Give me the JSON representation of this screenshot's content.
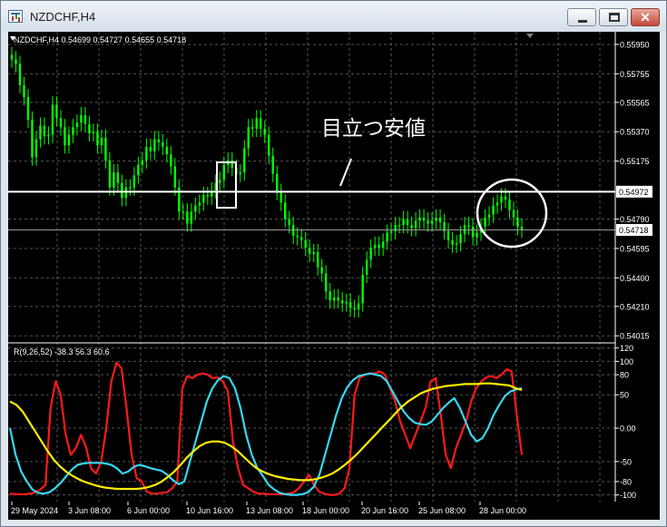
{
  "window": {
    "title": "NZDCHF,H4",
    "icon": "chart-window-icon",
    "buttons": {
      "minimize": "minimize-icon",
      "maximize": "maximize-icon",
      "close_glyph": "✕"
    }
  },
  "chart": {
    "symbol_info": "NZDCHF,H4  0.54699 0.54727 0.54655 0.54718",
    "price_axis": {
      "labels": [
        "0.55950",
        "0.55755",
        "0.55565",
        "0.55370",
        "0.55175",
        "0.54790",
        "0.54595",
        "0.54400",
        "0.54210",
        "0.54015"
      ],
      "horizontal_line_label": "0.54972",
      "current_price_label": "0.54718",
      "ylim": [
        0.5398,
        0.5601
      ]
    },
    "annotation": {
      "text": "目立つ安値"
    },
    "time_axis": [
      "29 May 2024",
      "3 Jun 08:00",
      "6 Jun 00:00",
      "10 Jun 16:00",
      "13 Jun 08:00",
      "18 Jun 00:00",
      "20 Jun 16:00",
      "25 Jun 08:00",
      "28 Jun 00:00"
    ],
    "indicator": {
      "label": "R(9,26,52) -38.3 56.3 60.6",
      "axis_labels": [
        "120",
        "100",
        "80",
        "50",
        "0.00",
        "-50",
        "-80",
        "-100"
      ],
      "ylim": [
        -110,
        125
      ]
    },
    "colors": {
      "background": "#000000",
      "candles": "#00ff00",
      "red_line": "#ff1a1a",
      "cyan_line": "#37d7f0",
      "yellow_line": "#ffee00",
      "grid": "#9a9a9a",
      "annotation": "#ffffff"
    }
  },
  "chart_data": {
    "type": "line",
    "price_series": {
      "closes": [
        0.5585,
        0.5582,
        0.5568,
        0.556,
        0.5545,
        0.552,
        0.5532,
        0.5541,
        0.5534,
        0.5535,
        0.5555,
        0.5546,
        0.554,
        0.5528,
        0.5535,
        0.554,
        0.5543,
        0.5548,
        0.5542,
        0.5536,
        0.5537,
        0.5528,
        0.5533,
        0.5518,
        0.55,
        0.551,
        0.5503,
        0.5493,
        0.55,
        0.55,
        0.5508,
        0.5515,
        0.5518,
        0.5527,
        0.5524,
        0.5532,
        0.553,
        0.5527,
        0.5522,
        0.5514,
        0.55,
        0.5484,
        0.5484,
        0.5476,
        0.5484,
        0.5488,
        0.549,
        0.5495,
        0.5494,
        0.5498,
        0.5503,
        0.5505,
        0.5515,
        0.5518,
        0.5513,
        0.5509,
        0.551,
        0.5526,
        0.554,
        0.5539,
        0.5546,
        0.5539,
        0.5535,
        0.5521,
        0.5509,
        0.5497,
        0.549,
        0.5479,
        0.5475,
        0.5468,
        0.5467,
        0.5465,
        0.546,
        0.5456,
        0.5457,
        0.5447,
        0.5443,
        0.5431,
        0.5425,
        0.5427,
        0.5425,
        0.5423,
        0.5424,
        0.542,
        0.5419,
        0.5423,
        0.5442,
        0.5452,
        0.546,
        0.5462,
        0.546,
        0.5464,
        0.547,
        0.5471,
        0.5475,
        0.5475,
        0.5479,
        0.5475,
        0.5473,
        0.5478,
        0.548,
        0.5478,
        0.5476,
        0.5478,
        0.548,
        0.5477,
        0.5471,
        0.5465,
        0.5462,
        0.5463,
        0.5469,
        0.5475,
        0.5474,
        0.5467,
        0.547,
        0.5474,
        0.548,
        0.5482,
        0.5488,
        0.549,
        0.5494,
        0.5492,
        0.5485,
        0.548,
        0.5474,
        0.5472
      ],
      "horizontal_line": 0.54972,
      "current_price": 0.54718
    },
    "indicator_series": [
      {
        "name": "red",
        "values": [
          -98,
          -99,
          -99,
          -99,
          -98,
          -96,
          -92,
          -85,
          30,
          70,
          50,
          -10,
          -40,
          -30,
          -10,
          -28,
          -60,
          -68,
          -50,
          0,
          70,
          98,
          90,
          30,
          -40,
          -75,
          -80,
          -95,
          -98,
          -98,
          -97,
          -96,
          -90,
          -80,
          60,
          78,
          75,
          80,
          82,
          80,
          75,
          76,
          70,
          55,
          -20,
          -60,
          -85,
          -90,
          -95,
          -98,
          -98,
          -99,
          -99,
          -99,
          -99,
          -98,
          -96,
          -90,
          -80,
          -70,
          -85,
          -95,
          -98,
          -100,
          -100,
          -98,
          -90,
          -60,
          50,
          75,
          80,
          82,
          82,
          85,
          80,
          60,
          40,
          10,
          -10,
          -30,
          -10,
          10,
          30,
          70,
          75,
          20,
          -40,
          -60,
          -30,
          -10,
          10,
          40,
          60,
          70,
          76,
          78,
          75,
          80,
          88,
          85,
          20,
          -40
        ]
      },
      {
        "name": "cyan",
        "values": [
          0,
          -40,
          -65,
          -80,
          -92,
          -97,
          -98,
          -96,
          -90,
          -82,
          -72,
          -62,
          -55,
          -53,
          -52,
          -52,
          -52,
          -53,
          -55,
          -60,
          -68,
          -65,
          -58,
          -55,
          -57,
          -60,
          -62,
          -64,
          -70,
          -78,
          -84,
          -80,
          -50,
          -20,
          10,
          40,
          60,
          72,
          78,
          75,
          60,
          30,
          -10,
          -40,
          -60,
          -72,
          -85,
          -92,
          -97,
          -99,
          -100,
          -100,
          -99,
          -96,
          -88,
          -70,
          -40,
          -10,
          20,
          45,
          62,
          72,
          78,
          80,
          82,
          80,
          78,
          70,
          55,
          40,
          25,
          15,
          8,
          6,
          5,
          10,
          20,
          30,
          38,
          45,
          30,
          10,
          -10,
          -20,
          -15,
          0,
          20,
          35,
          48,
          55,
          58,
          60
        ]
      },
      {
        "name": "yellow",
        "values": [
          40,
          35,
          25,
          10,
          -5,
          -20,
          -35,
          -48,
          -58,
          -66,
          -72,
          -77,
          -81,
          -84,
          -87,
          -89,
          -90,
          -91,
          -91,
          -91,
          -91,
          -90,
          -88,
          -85,
          -80,
          -73,
          -65,
          -55,
          -44,
          -35,
          -27,
          -22,
          -20,
          -20,
          -22,
          -27,
          -34,
          -43,
          -52,
          -60,
          -65,
          -69,
          -72,
          -74,
          -76,
          -77,
          -78,
          -78,
          -77,
          -75,
          -72,
          -68,
          -62,
          -55,
          -47,
          -38,
          -28,
          -18,
          -8,
          2,
          12,
          22,
          32,
          40,
          46,
          52,
          56,
          59,
          61,
          63,
          64,
          65,
          66,
          66,
          66,
          67,
          67,
          66,
          65,
          64,
          60,
          57
        ]
      }
    ]
  }
}
